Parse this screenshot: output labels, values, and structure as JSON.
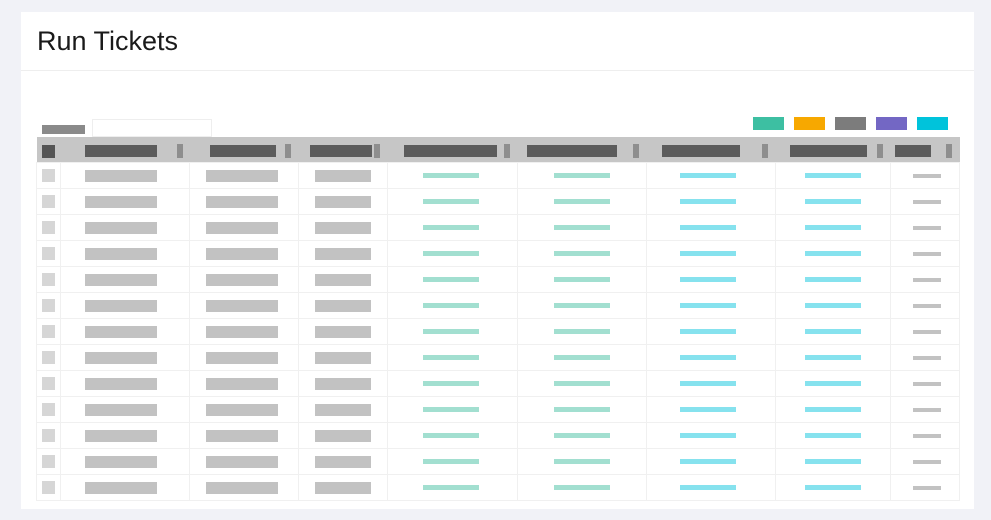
{
  "page": {
    "title": "Run Tickets"
  },
  "toolbar": {
    "filter_label": "",
    "filter_value": "",
    "filter_placeholder": ""
  },
  "legend": [
    {
      "name": "legend-green",
      "color": "#3dbfa2"
    },
    {
      "name": "legend-orange",
      "color": "#f7a800"
    },
    {
      "name": "legend-gray",
      "color": "#7c7c7c"
    },
    {
      "name": "legend-purple",
      "color": "#7367c4"
    },
    {
      "name": "legend-cyan",
      "color": "#00c3db"
    }
  ],
  "table": {
    "row_count": 13,
    "columns": [
      {
        "header": "",
        "cell": "gray"
      },
      {
        "header": "",
        "cell": "gray"
      },
      {
        "header": "",
        "cell": "gray"
      },
      {
        "header": "",
        "cell": "teal"
      },
      {
        "header": "",
        "cell": "teal"
      },
      {
        "header": "",
        "cell": "cyan"
      },
      {
        "header": "",
        "cell": "cyan"
      },
      {
        "header": "",
        "cell": "dash"
      }
    ],
    "colors": {
      "gray": "#c2c2c2",
      "teal": "#a2dfd0",
      "cyan": "#86e2ee",
      "dash": "#c2c2c2"
    }
  }
}
